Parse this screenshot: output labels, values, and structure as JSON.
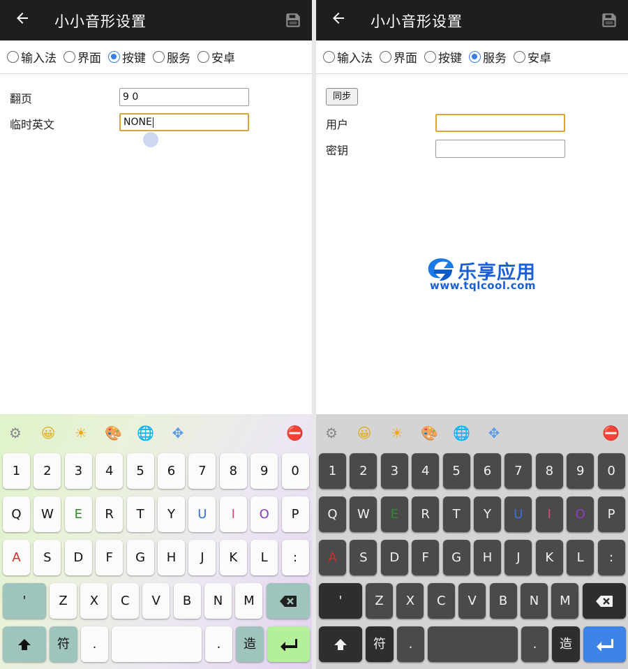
{
  "app": {
    "title": "小小音形设置"
  },
  "tabs": [
    "输入法",
    "界面",
    "按键",
    "服务",
    "安卓"
  ],
  "left": {
    "selected_tab": "按键",
    "fields": [
      {
        "label": "翻页",
        "value": "9 0"
      },
      {
        "label": "临时英文",
        "value": "NONE"
      }
    ]
  },
  "right": {
    "selected_tab": "服务",
    "sync_label": "同步",
    "fields": [
      {
        "label": "用户",
        "value": ""
      },
      {
        "label": "密钥",
        "value": ""
      }
    ]
  },
  "watermark": {
    "name": "乐享应用",
    "url": "www.tqlcool.com"
  },
  "keyboard": {
    "toolbar_icons": [
      "gear-icon",
      "smiley-icon",
      "sun-icon",
      "palette-icon",
      "globe-icon",
      "move-icon",
      "minus-stop-icon"
    ],
    "row1": [
      "1",
      "2",
      "3",
      "4",
      "5",
      "6",
      "7",
      "8",
      "9",
      "0"
    ],
    "row2": [
      "Q",
      "W",
      "E",
      "R",
      "T",
      "Y",
      "U",
      "I",
      "O",
      "P"
    ],
    "row3": [
      "A",
      "S",
      "D",
      "F",
      "G",
      "H",
      "J",
      "K",
      "L",
      ":"
    ],
    "row4": [
      "'",
      "Z",
      "X",
      "C",
      "V",
      "B",
      "N",
      "M"
    ],
    "row5": {
      "fu": "符",
      "dot1": ".",
      "dot2": ".",
      "zao": "造"
    },
    "colors": {
      "E": "#2d8a2d",
      "U": "#3a6fd8",
      "I": "#d0507a",
      "O": "#8a3fc0",
      "A": "#d22d2d"
    }
  }
}
